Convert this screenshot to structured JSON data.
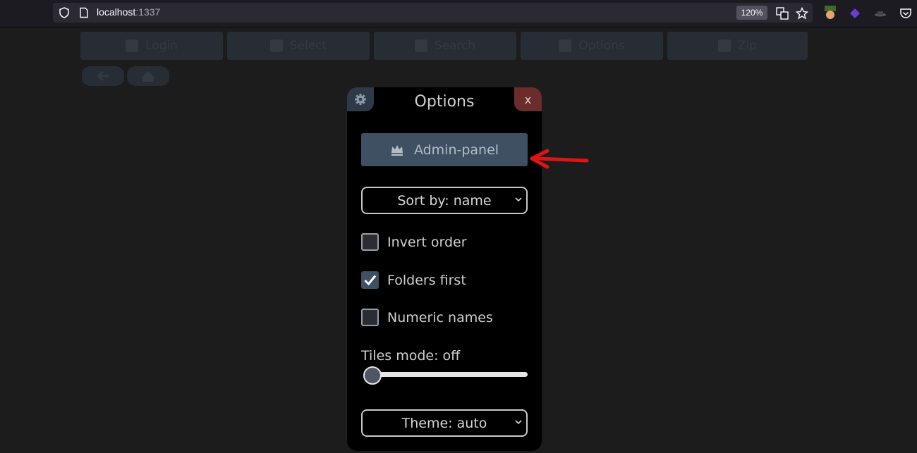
{
  "browser": {
    "url_host": "localhost",
    "url_port": ":1337",
    "zoom": "120%"
  },
  "toolbar": {
    "buttons": [
      {
        "label": "Login",
        "icon": "user-icon"
      },
      {
        "label": "Select",
        "icon": "check-icon"
      },
      {
        "label": "Search",
        "icon": "search-icon"
      },
      {
        "label": "Options",
        "icon": "gear-icon"
      },
      {
        "label": "Zip",
        "icon": "zip-file-icon"
      }
    ]
  },
  "options_modal": {
    "title": "Options",
    "close_label": "x",
    "admin_button_label": "Admin-panel",
    "sort_select": "Sort by: name",
    "checkboxes": [
      {
        "label": "Invert order",
        "checked": false
      },
      {
        "label": "Folders first",
        "checked": true
      },
      {
        "label": "Numeric names",
        "checked": false
      }
    ],
    "tiles_label": "Tiles mode: off",
    "tiles_level": 0,
    "theme_select": "Theme: auto"
  },
  "colors": {
    "annotation_arrow": "#e11414",
    "accent": "#3e5062",
    "close": "#6b2c2c"
  }
}
